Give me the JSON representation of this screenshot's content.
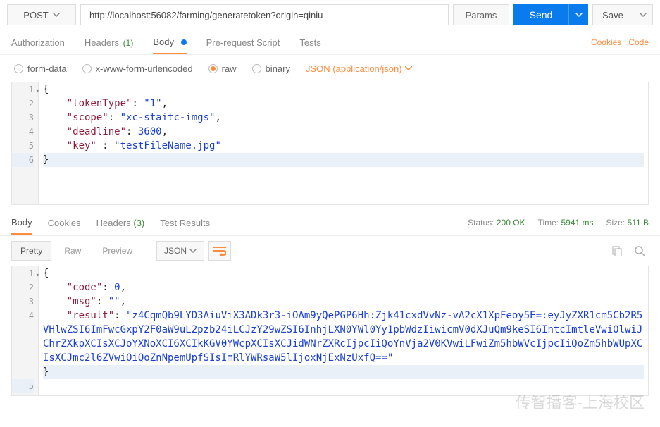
{
  "method": "POST",
  "url": "http://localhost:56082/farming/generatetoken?origin=qiniu",
  "buttons": {
    "params": "Params",
    "send": "Send",
    "save": "Save"
  },
  "reqTabs": {
    "authorization": "Authorization",
    "headers": "Headers",
    "headersCount": "(1)",
    "body": "Body",
    "prerequest": "Pre-request Script",
    "tests": "Tests"
  },
  "links": {
    "cookies": "Cookies",
    "code": "Code"
  },
  "bodyTypes": {
    "formdata": "form-data",
    "xwww": "x-www-form-urlencoded",
    "raw": "raw",
    "binary": "binary",
    "jsonType": "JSON (application/json)"
  },
  "requestBody": {
    "l1": "{",
    "l2_k": "\"tokenType\"",
    "l2_v": "\"1\"",
    "l3_k": "\"scope\"",
    "l3_v": "\"xc-staitc-imgs\"",
    "l4_k": "\"deadline\"",
    "l4_v": "3600",
    "l5_k": "\"key\"",
    "l5_v": "\"testFileName.jpg\"",
    "l6": "}"
  },
  "respTabs": {
    "body": "Body",
    "cookies": "Cookies",
    "headers": "Headers",
    "headersCount": "(3)",
    "tests": "Test Results"
  },
  "respMeta": {
    "statusLabel": "Status:",
    "statusValue": "200 OK",
    "timeLabel": "Time:",
    "timeValue": "5941 ms",
    "sizeLabel": "Size:",
    "sizeValue": "511 B"
  },
  "viewBtns": {
    "pretty": "Pretty",
    "raw": "Raw",
    "preview": "Preview",
    "json": "JSON"
  },
  "responseBody": {
    "code_k": "\"code\"",
    "code_v": "0",
    "msg_k": "\"msg\"",
    "msg_v": "\"\"",
    "result_k": "\"result\"",
    "result_v": "\"z4CqmQb9LYD3AiuViX3ADk3r3-iOAm9yQePGP6Hh:Zjk41cxdVvNz-vA2cX1XpFeoy5E=:eyJyZXR1cm5Cb2R5VHlwZSI6ImFwcGxpY2F0aW9uL2pzb24iLCJzY29wZSI6InhjLXN0YWl0Yy1pbWdzIiwicmV0dXJuQm9keSI6IntcImtleVwiOlwiJChrZXkpXCIsXCJoYXNoXCI6XCIkKGV0YWcpXCIsXCJidWNrZXRcIjpcIiQoYnVja2V0KVwiLFwiZm5hbWVcIjpcIiQoZm5hbWUpXCIsXCJmc2l6ZVwiOiQoZnNpemUpfSIsImRlYWRsaW5lIjoxNjExNzUxfQ==\""
  },
  "watermark": "传智播客-上海校区"
}
